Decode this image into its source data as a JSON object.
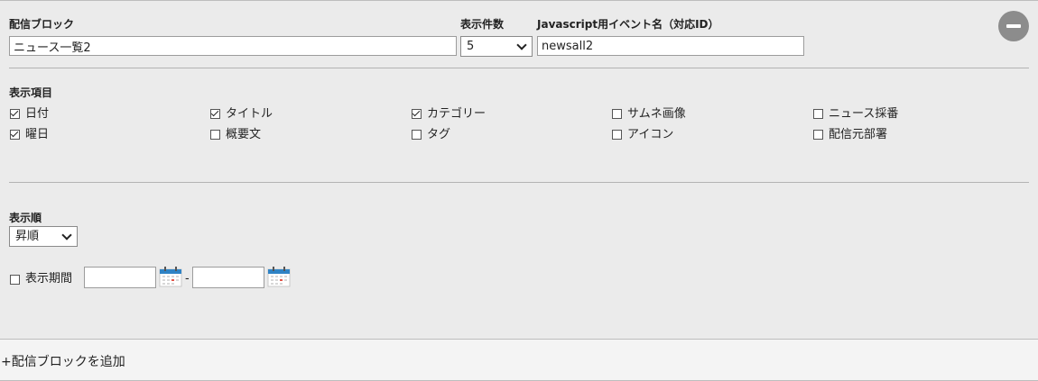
{
  "block": {
    "name_label": "配信ブロック",
    "name_value": "ニュース一覧2",
    "count_label": "表示件数",
    "count_value": "5",
    "event_label": "Javascript用イベント名（対応ID）",
    "event_value": "newsall2"
  },
  "display_items": {
    "label": "表示項目",
    "items": [
      {
        "label": "日付",
        "checked": true
      },
      {
        "label": "タイトル",
        "checked": true
      },
      {
        "label": "カテゴリー",
        "checked": true
      },
      {
        "label": "サムネ画像",
        "checked": false
      },
      {
        "label": "ニュース採番",
        "checked": false
      },
      {
        "label": "曜日",
        "checked": true
      },
      {
        "label": "概要文",
        "checked": false
      },
      {
        "label": "タグ",
        "checked": false
      },
      {
        "label": "アイコン",
        "checked": false
      },
      {
        "label": "配信元部署",
        "checked": false
      }
    ]
  },
  "order": {
    "label": "表示順",
    "value": "昇順"
  },
  "period": {
    "label": "表示期間",
    "checked": false,
    "separator": "-",
    "start_value": "",
    "end_value": ""
  },
  "footer": {
    "add_label": "+配信ブロックを追加"
  },
  "icons": {
    "remove": "minus-circle-icon",
    "calendar": "calendar-icon",
    "dropdown": "chevron-down-icon"
  },
  "colors": {
    "panel_bg": "#ebebeb",
    "remove_button": "#8c8c8c",
    "calendar_header": "#2f83c5",
    "calendar_mark": "#e2564a"
  }
}
